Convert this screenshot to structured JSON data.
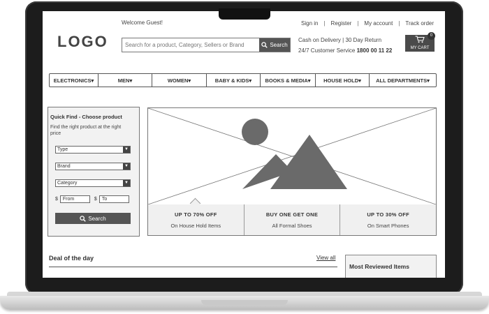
{
  "header": {
    "welcome": "Welcome Guest!",
    "links": [
      "Sign in",
      "Register",
      "My account",
      "Track order"
    ],
    "logo": "LOGO",
    "search_placeholder": "Search for a product, Category, Sellers or Brand",
    "search_button": "Search",
    "delivery_info": "Cash on Delivery | 30 Day Return",
    "service_label": "24/7 Customer Service",
    "service_phone": "1800 00 11 22",
    "cart_label": "MY CART",
    "cart_count": "0"
  },
  "nav": {
    "items": [
      "ELECTRONICS",
      "MEN",
      "WOMEN",
      "BABY & KIDS",
      "BOOKS & MEDIA",
      "HOUSE HOLD",
      "ALL DEPARTMENTS"
    ]
  },
  "quick_find": {
    "title": "Quick Find - Choose product",
    "subtitle": "Find the right product at the right price",
    "selects": [
      "Type",
      "Brand",
      "Category"
    ],
    "currency": "$",
    "from": "From",
    "to": "To",
    "search_button": "Search"
  },
  "offers": [
    {
      "title": "UP TO 70% OFF",
      "subtitle": "On House Hold Items"
    },
    {
      "title": "BUY ONE GET ONE",
      "subtitle": "All Formal Shoes"
    },
    {
      "title": "UP TO 30% OFF",
      "subtitle": "On Smart Phones"
    }
  ],
  "deal": {
    "title": "Deal of the day",
    "view_all": "View all"
  },
  "sidebar": {
    "most_reviewed": "Most Reviewed Items"
  }
}
